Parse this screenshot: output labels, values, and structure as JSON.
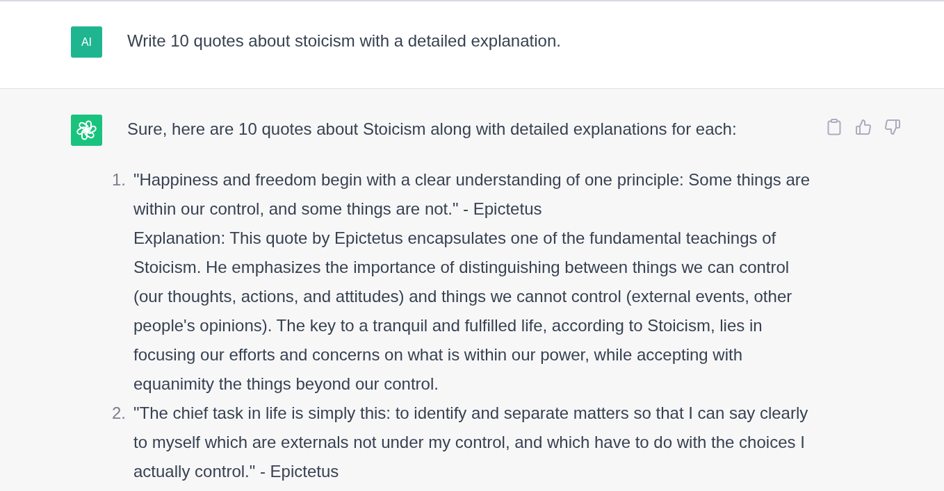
{
  "prompt": {
    "avatar_text": "AI",
    "text": "Write 10 quotes about stoicism with a detailed explanation."
  },
  "response": {
    "intro": "Sure, here are 10 quotes about Stoicism along with detailed explanations for each:",
    "actions": [
      {
        "kind": "copy"
      },
      {
        "kind": "like"
      },
      {
        "kind": "dislike"
      }
    ],
    "items": [
      {
        "number": "1.",
        "quote": "\"Happiness and freedom begin with a clear understanding of one principle: Some things are within our control, and some things are not.\" - Epictetus",
        "explanation": "Explanation: This quote by Epictetus encapsulates one of the fundamental teachings of Stoicism. He emphasizes the importance of distinguishing between things we can control (our thoughts, actions, and attitudes) and things we cannot control (external events, other people's opinions). The key to a tranquil and fulfilled life, according to Stoicism, lies in focusing our efforts and concerns on what is within our power, while accepting with equanimity the things beyond our control."
      },
      {
        "number": "2.",
        "quote": "\"The chief task in life is simply this: to identify and separate matters so that I can say clearly to myself which are externals not under my control, and which have to do with the choices I actually control.\" - Epictetus"
      }
    ]
  }
}
